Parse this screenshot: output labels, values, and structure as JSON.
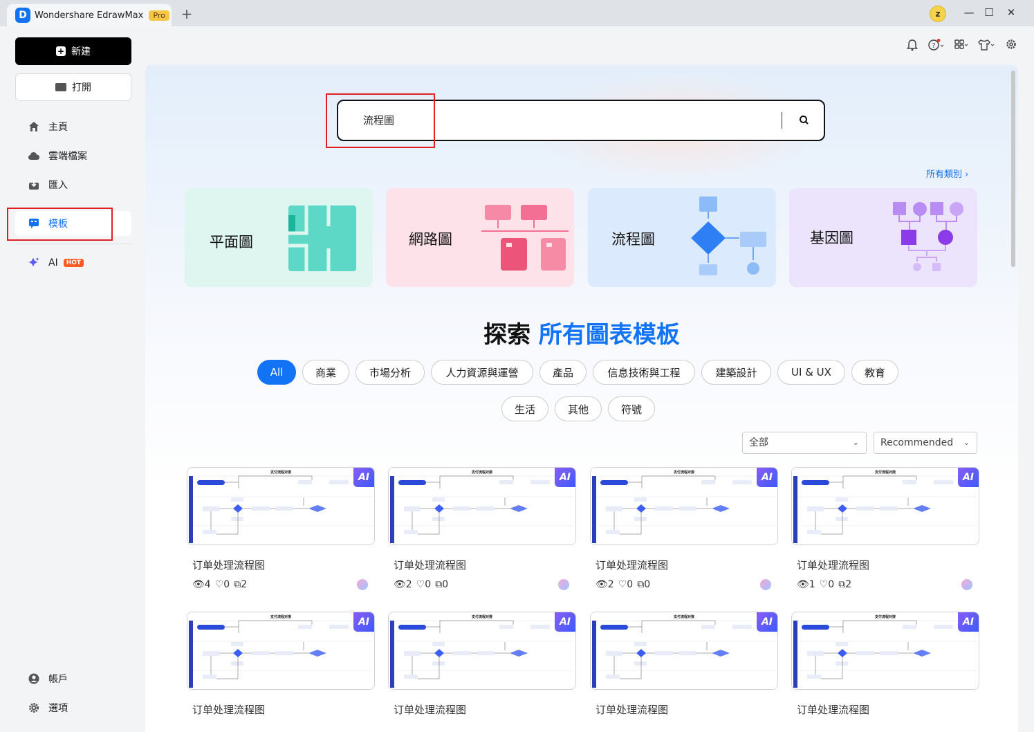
{
  "titlebar": {
    "app_title": "Wondershare EdrawMax",
    "pro_badge": "Pro",
    "new_tab": "+",
    "user_initial": "z",
    "minimize": "—",
    "maximize": "☐",
    "close": "✕"
  },
  "sidebar": {
    "new_label": "新建",
    "open_label": "打開",
    "items": [
      {
        "label": "主頁",
        "icon": "home-icon"
      },
      {
        "label": "雲端檔案",
        "icon": "cloud-icon"
      },
      {
        "label": "匯入",
        "icon": "import-icon"
      },
      {
        "label": "模板",
        "icon": "template-icon"
      },
      {
        "label": "AI",
        "icon": "sparkle-icon",
        "badge": "HOT"
      }
    ],
    "account_label": "帳戶",
    "options_label": "選項"
  },
  "search": {
    "value": "流程圖"
  },
  "all_categories": "所有類別 ›",
  "categories": [
    {
      "label": "平面圖",
      "color": "#dff6f0"
    },
    {
      "label": "網路圖",
      "color": "#fde2ea"
    },
    {
      "label": "流程圖",
      "color": "#dceafd"
    },
    {
      "label": "基因圖",
      "color": "#ece4fc"
    }
  ],
  "explore": {
    "prefix": "探索",
    "highlight": "所有圖表模板"
  },
  "filters": [
    "All",
    "商業",
    "市場分析",
    "人力資源與運營",
    "產品",
    "信息技術與工程",
    "建築設計",
    "UI & UX",
    "教育",
    "生活",
    "其他",
    "符號"
  ],
  "sort": {
    "scope": "全部",
    "order": "Recommended"
  },
  "templates": [
    {
      "title": "订单处理流程图",
      "views": "4",
      "likes": "0",
      "copies": "2"
    },
    {
      "title": "订单处理流程图",
      "views": "2",
      "likes": "0",
      "copies": "0"
    },
    {
      "title": "订单处理流程图",
      "views": "2",
      "likes": "0",
      "copies": "0"
    },
    {
      "title": "订单处理流程图",
      "views": "1",
      "likes": "0",
      "copies": "2"
    },
    {
      "title": "订单处理流程图"
    },
    {
      "title": "订单处理流程图"
    },
    {
      "title": "订单处理流程图"
    },
    {
      "title": "订单处理流程图"
    }
  ],
  "thumb_title": "支付流程对接",
  "ai_badge": "AI",
  "colors": {
    "accent": "#1273f5",
    "highlight_box": "#e02020"
  }
}
